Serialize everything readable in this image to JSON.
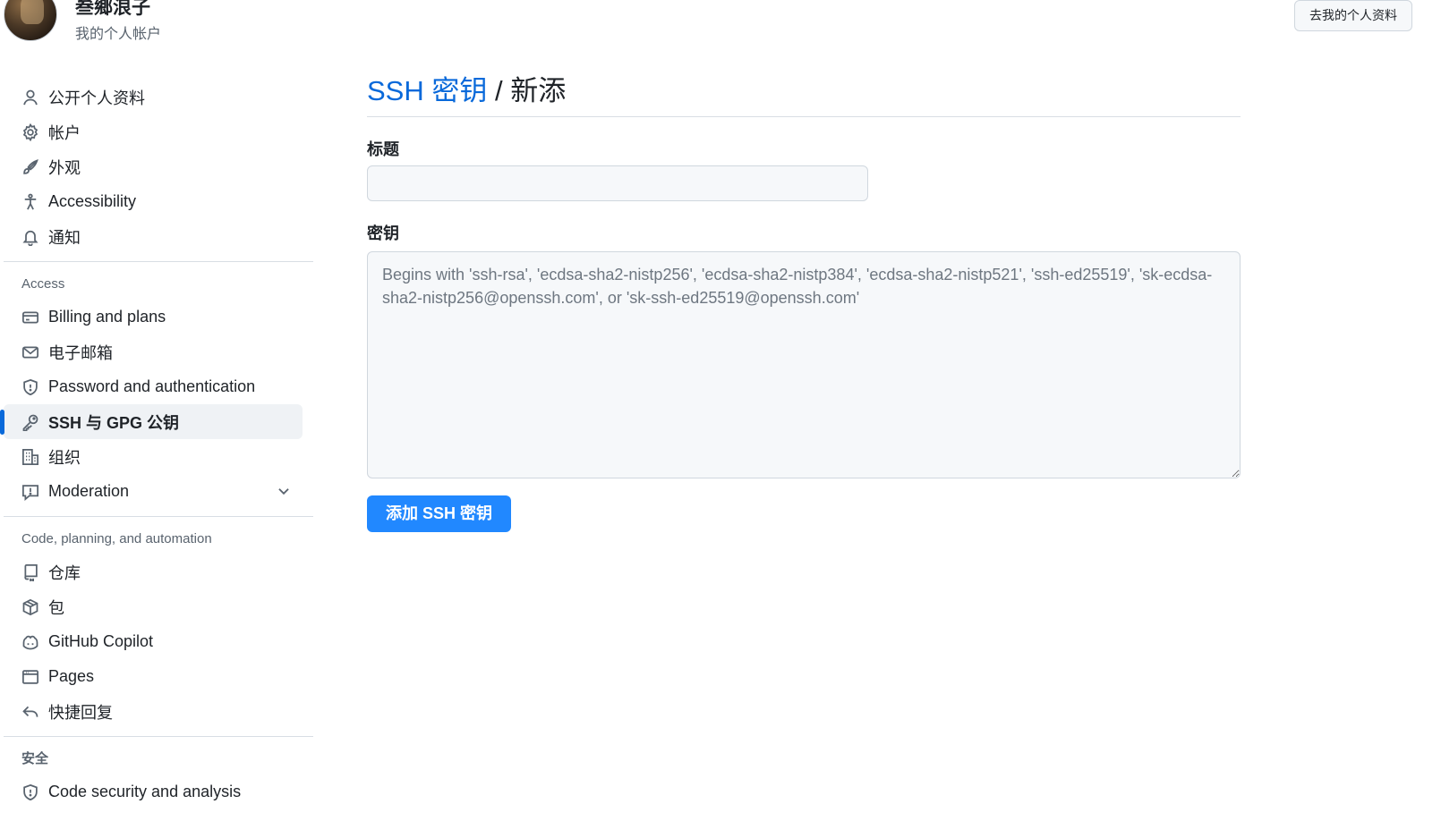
{
  "header": {
    "user_name": "叁鄉浪子",
    "user_subtitle": "我的个人帐户",
    "profile_button": "去我的个人资料"
  },
  "sidebar": {
    "group1": [
      {
        "label": "公开个人资料",
        "icon": "person-icon"
      },
      {
        "label": "帐户",
        "icon": "gear-icon"
      },
      {
        "label": "外观",
        "icon": "paintbrush-icon"
      },
      {
        "label": "Accessibility",
        "icon": "accessibility-icon"
      },
      {
        "label": "通知",
        "icon": "bell-icon"
      }
    ],
    "access_heading": "Access",
    "access": [
      {
        "label": "Billing and plans",
        "icon": "credit-card-icon"
      },
      {
        "label": "电子邮箱",
        "icon": "mail-icon"
      },
      {
        "label": "Password and authentication",
        "icon": "shield-icon"
      },
      {
        "label": "SSH 与 GPG 公钥",
        "icon": "key-icon",
        "active": true
      },
      {
        "label": "组织",
        "icon": "organization-icon"
      },
      {
        "label": "Moderation",
        "icon": "report-icon",
        "expandable": true
      }
    ],
    "code_heading": "Code, planning, and automation",
    "code": [
      {
        "label": "仓库",
        "icon": "repo-icon"
      },
      {
        "label": "包",
        "icon": "package-icon"
      },
      {
        "label": "GitHub Copilot",
        "icon": "copilot-icon"
      },
      {
        "label": "Pages",
        "icon": "browser-icon"
      },
      {
        "label": "快捷回复",
        "icon": "reply-icon"
      }
    ],
    "security_heading": "安全",
    "security": [
      {
        "label": "Code security and analysis",
        "icon": "shield-icon"
      }
    ]
  },
  "main": {
    "breadcrumb": "SSH 密钥",
    "title_separator": " / ",
    "title_page": "新添",
    "title_label": "标题",
    "title_value": "",
    "key_label": "密钥",
    "key_placeholder": "Begins with 'ssh-rsa', 'ecdsa-sha2-nistp256', 'ecdsa-sha2-nistp384', 'ecdsa-sha2-nistp521', 'ssh-ed25519', 'sk-ecdsa-sha2-nistp256@openssh.com', or 'sk-ssh-ed25519@openssh.com'",
    "submit_label": "添加 SSH 密钥"
  },
  "colors": {
    "accent": "#0969da",
    "primary_button": "#2188ff",
    "text": "#1f2328",
    "muted": "#59636e"
  }
}
